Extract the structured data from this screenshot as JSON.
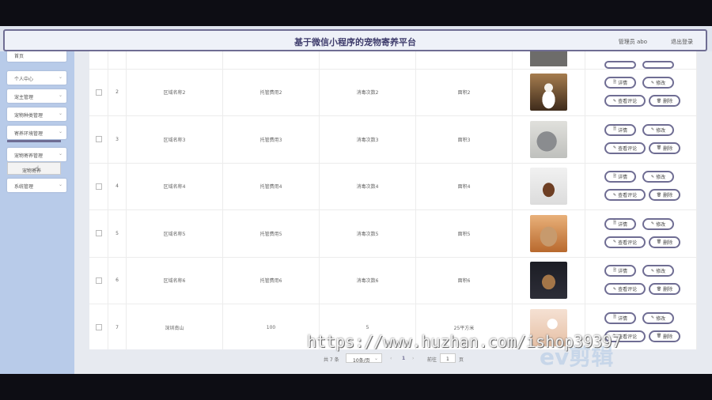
{
  "header": {
    "title": "基于微信小程序的宠物寄养平台",
    "user": "管理员 abo",
    "logout": "退出登录"
  },
  "sidebar": {
    "items": [
      {
        "label": "首页",
        "chevron": ""
      },
      {
        "label": "个人中心",
        "chevron": "⌄"
      },
      {
        "label": "宠主管理",
        "chevron": "⌄"
      },
      {
        "label": "宠物种类管理",
        "chevron": "⌄"
      },
      {
        "label": "寄养环境管理",
        "chevron": "⌄"
      },
      {
        "label": "宠物寄养管理",
        "chevron": "⌄"
      },
      {
        "label": "系统管理",
        "chevron": "⌄"
      }
    ],
    "submenu": "宠物寄养"
  },
  "table": {
    "rows": [
      {
        "no": "2",
        "name": "区域名称2",
        "fee": "托管费用2",
        "disinfect": "消毒次数2",
        "area": "面积2",
        "photo": "cat-photo"
      },
      {
        "no": "3",
        "name": "区域名称3",
        "fee": "托管费用3",
        "disinfect": "消毒次数3",
        "area": "面积3",
        "photo": "grey-cat-photo"
      },
      {
        "no": "4",
        "name": "区域名称4",
        "fee": "托管费用4",
        "disinfect": "消毒次数4",
        "area": "面积4",
        "photo": "dog-photo"
      },
      {
        "no": "5",
        "name": "区域名称5",
        "fee": "托管费用5",
        "disinfect": "消毒次数5",
        "area": "面积5",
        "photo": "pug-photo"
      },
      {
        "no": "6",
        "name": "区域名称6",
        "fee": "托管费用6",
        "disinfect": "消毒次数6",
        "area": "面积6",
        "photo": "puppy-photo"
      },
      {
        "no": "7",
        "name": "深圳南山",
        "fee": "100",
        "disinfect": "5",
        "area": "25平方米",
        "photo": "room-photo"
      }
    ],
    "actions": {
      "detail": "详情",
      "edit": "修改",
      "review": "查看评论",
      "delete": "删除"
    }
  },
  "pagination": {
    "total": "共 7 条",
    "page_size": "10条/页",
    "current": "1",
    "goto": "前往",
    "goto_value": "1",
    "page_unit": "页",
    "prev": "‹",
    "next": "›"
  },
  "watermark": "https://www.huzhan.com/ishop39397",
  "logo": "ev剪辑",
  "colors": {
    "accent": "#6f6d93",
    "sidebar": "#b8cbe9",
    "title": "#3e3c6c"
  }
}
